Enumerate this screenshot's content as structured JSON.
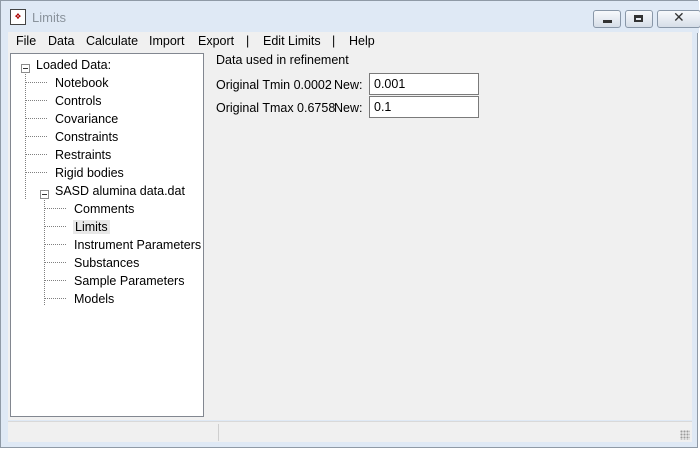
{
  "window": {
    "title": "Limits",
    "app_icon": "gsas-logo-icon"
  },
  "menu": [
    "File",
    "Data",
    "Calculate",
    "Import",
    "Export",
    "|",
    "Edit Limits",
    "|",
    "Help"
  ],
  "tree": {
    "root": "Loaded Data:",
    "items": [
      "Notebook",
      "Controls",
      "Covariance",
      "Constraints",
      "Restraints",
      "Rigid bodies"
    ],
    "dataset": {
      "label": "SASD alumina data.dat",
      "children": [
        "Comments",
        "Limits",
        "Instrument Parameters",
        "Substances",
        "Sample Parameters",
        "Models"
      ],
      "selected": "Limits"
    }
  },
  "panel": {
    "heading": "Data used in refinement",
    "tmin": {
      "label": "Original Tmin 0.0002",
      "new_label": "New:",
      "value": "0.001"
    },
    "tmax": {
      "label": "Original Tmax 0.6758",
      "new_label": "New:",
      "value": "0.1"
    }
  }
}
